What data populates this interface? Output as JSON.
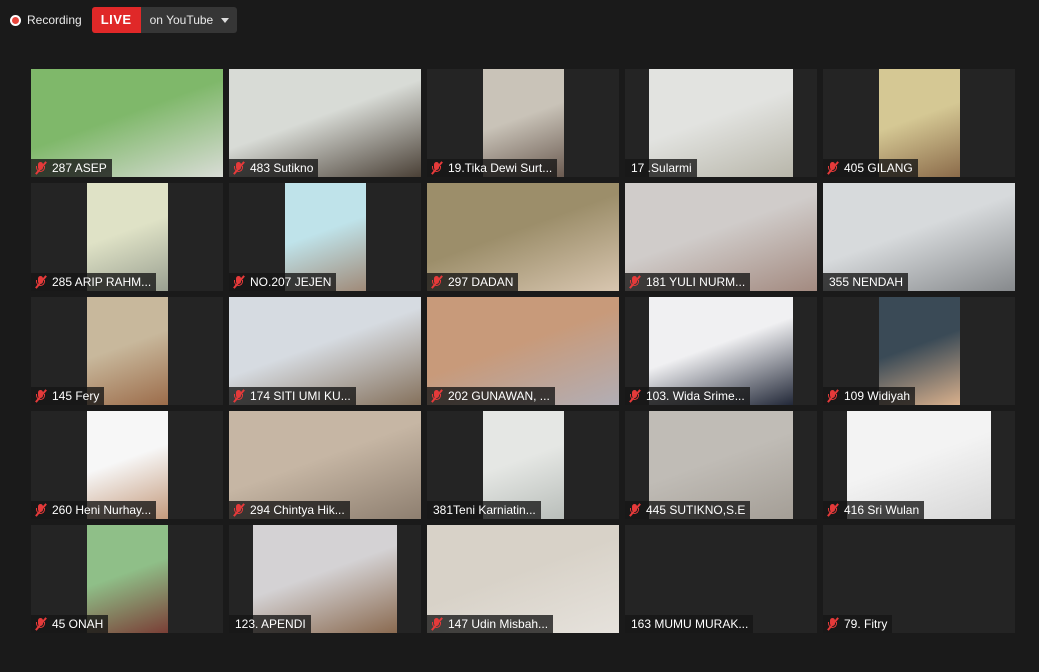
{
  "topbar": {
    "recording_label": "Recording",
    "live_label": "LIVE",
    "stream_target": "on YouTube"
  },
  "participants": [
    {
      "name": "287 ASEP",
      "muted": true
    },
    {
      "name": "483 Sutikno",
      "muted": true
    },
    {
      "name": "19.Tika Dewi Surt...",
      "muted": true
    },
    {
      "name": "17 .Sularmi",
      "muted": false
    },
    {
      "name": "405 GILANG",
      "muted": true
    },
    {
      "name": "285 ARIP RAHM...",
      "muted": true
    },
    {
      "name": "NO.207 JEJEN",
      "muted": true
    },
    {
      "name": "297 DADAN",
      "muted": true
    },
    {
      "name": "181 YULI NURM...",
      "muted": true
    },
    {
      "name": "355 NENDAH",
      "muted": false
    },
    {
      "name": "145 Fery",
      "muted": true
    },
    {
      "name": "174 SITI UMI KU...",
      "muted": true
    },
    {
      "name": "202 GUNAWAN, ...",
      "muted": true
    },
    {
      "name": "103. Wida Srime...",
      "muted": true
    },
    {
      "name": "109 Widiyah",
      "muted": true
    },
    {
      "name": "260 Heni Nurhay...",
      "muted": true
    },
    {
      "name": "294 Chintya Hik...",
      "muted": true
    },
    {
      "name": "381Teni Karniatin...",
      "muted": false
    },
    {
      "name": "445 SUTIKNO,S.E",
      "muted": true
    },
    {
      "name": "416 Sri Wulan",
      "muted": true
    },
    {
      "name": "45 ONAH",
      "muted": true
    },
    {
      "name": "123. APENDI",
      "muted": false
    },
    {
      "name": "147 Udin Misbah...",
      "muted": true
    },
    {
      "name": "163 MUMU MURAK...",
      "muted": false
    },
    {
      "name": "79. Fitry",
      "muted": true
    }
  ],
  "colors": {
    "live_badge": "#e02828",
    "muted_icon": "#e53a3a",
    "background": "#1a1a1a"
  }
}
